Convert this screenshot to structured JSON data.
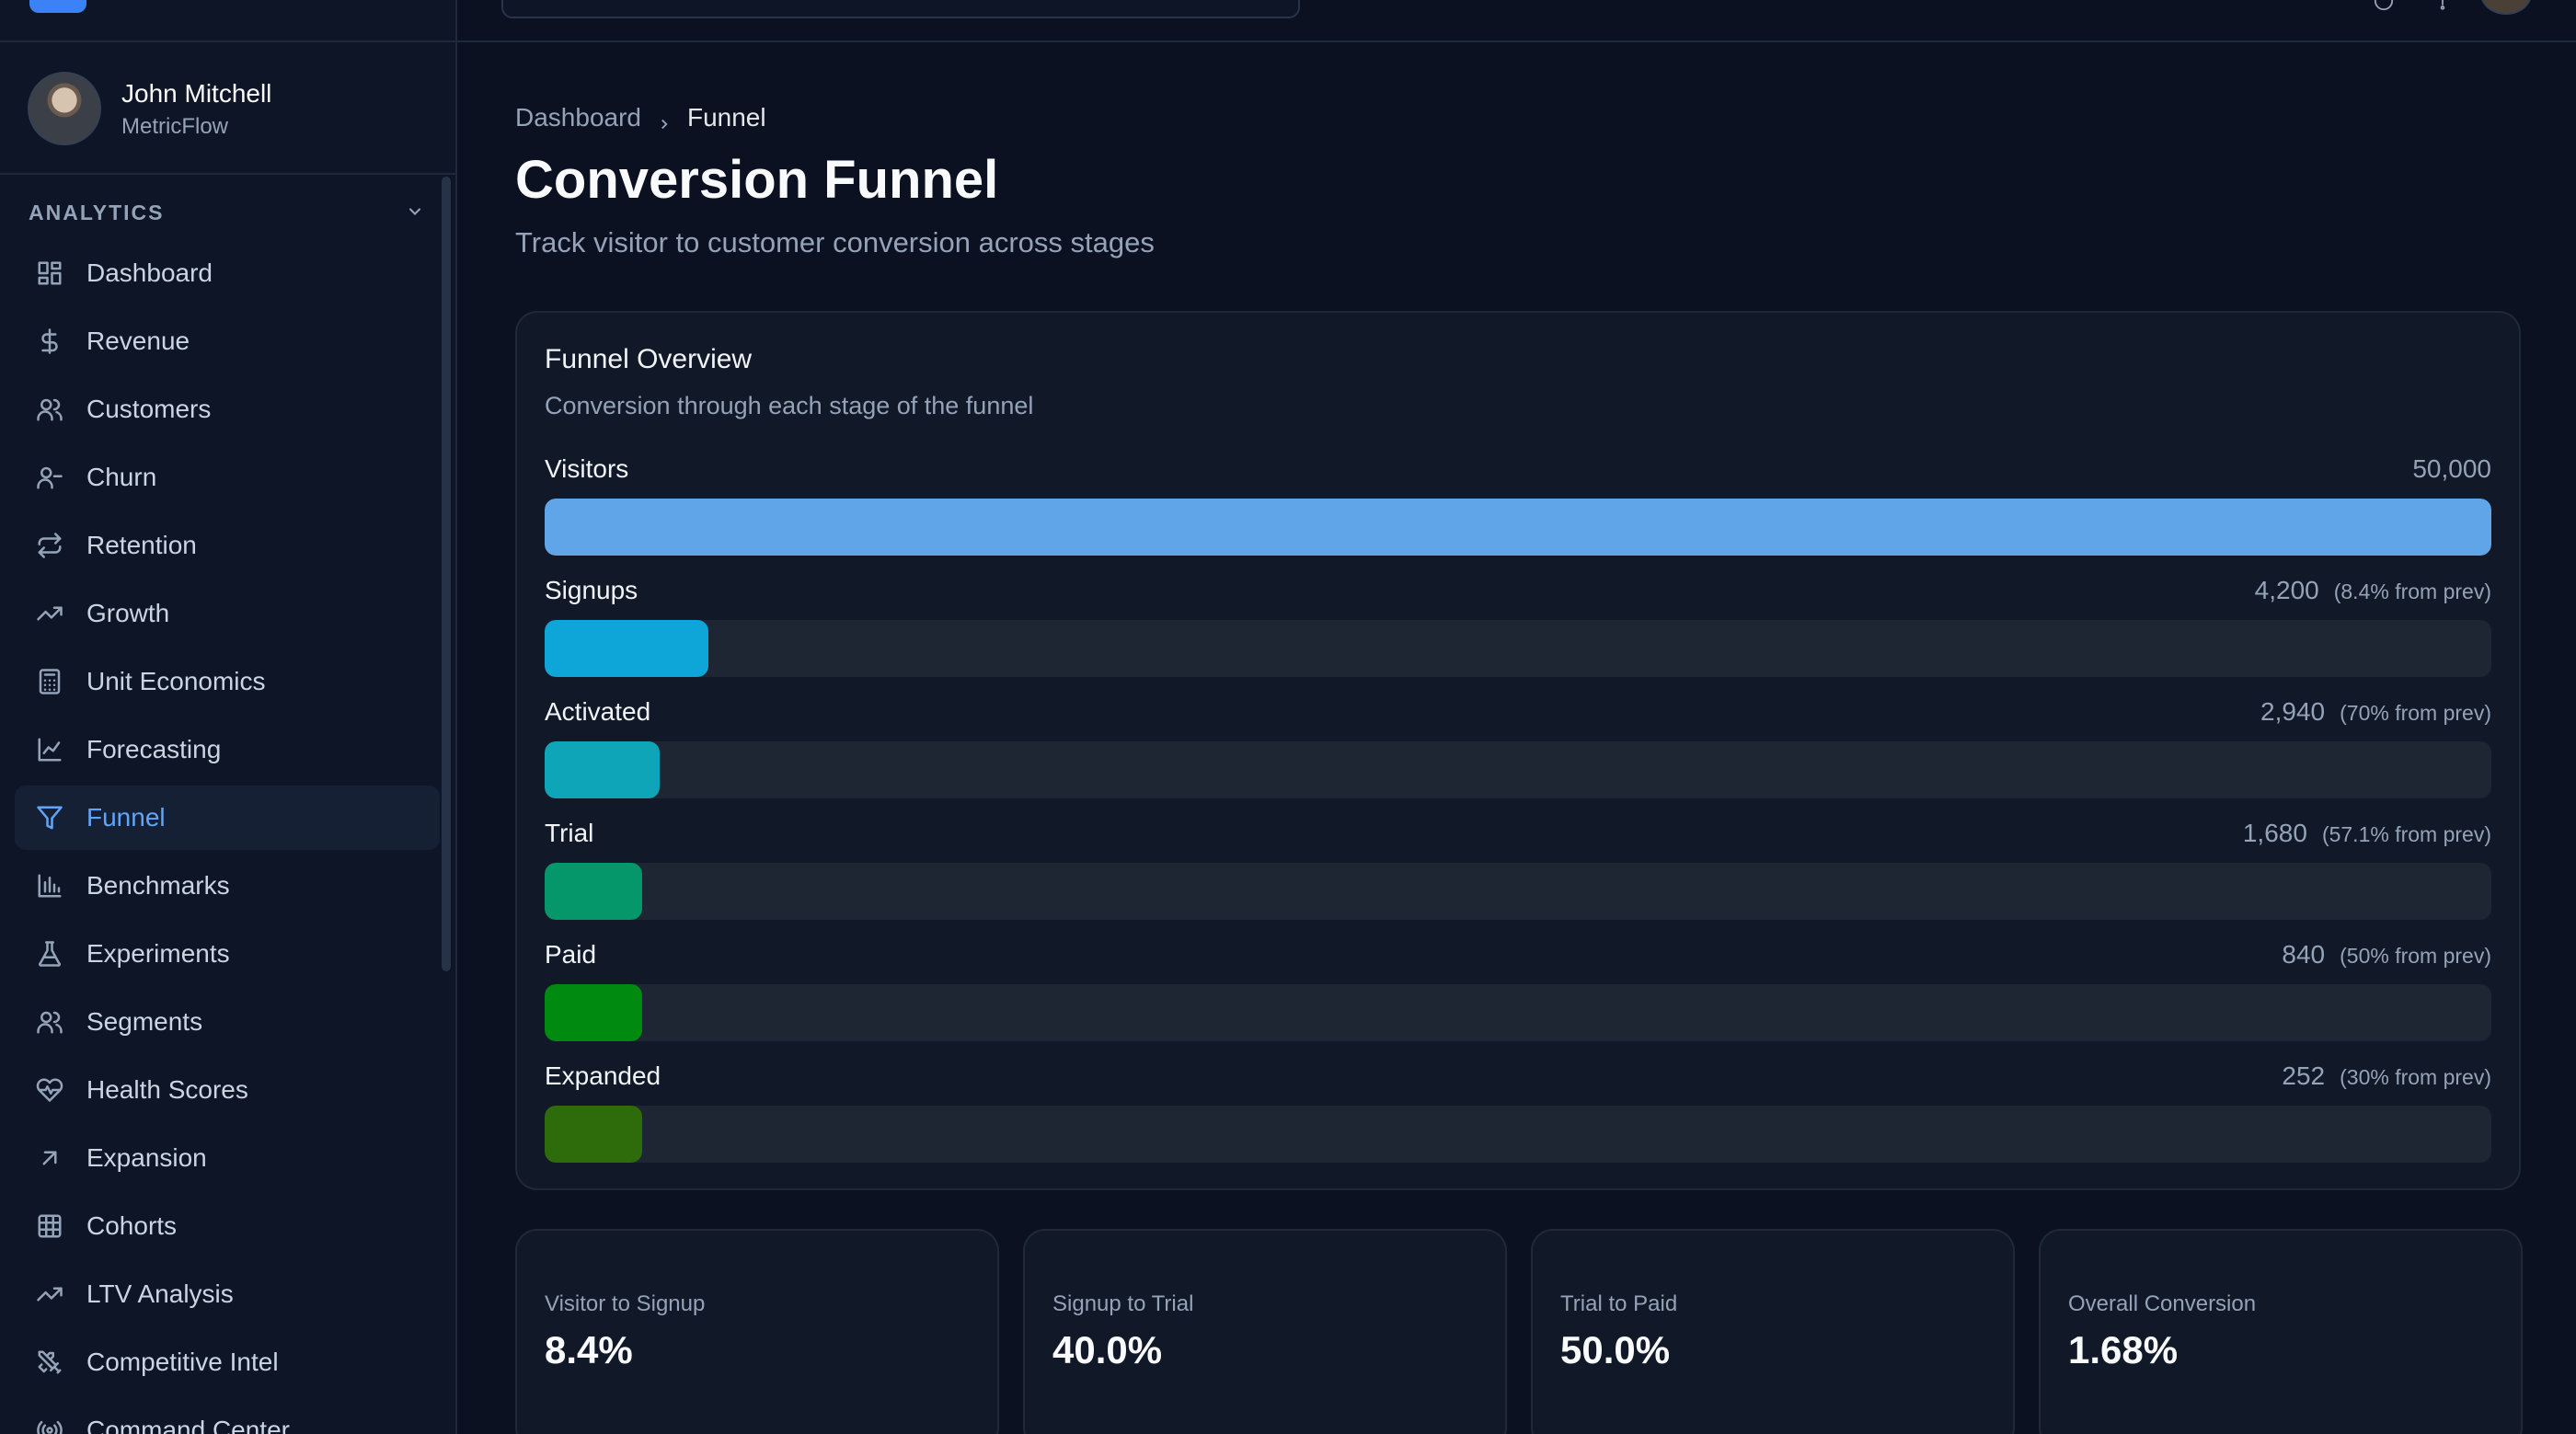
{
  "user": {
    "name": "John Mitchell",
    "org": "MetricFlow"
  },
  "sidebar": {
    "section_title": "ANALYTICS",
    "items": [
      {
        "label": "Dashboard",
        "icon": "dashboard-icon"
      },
      {
        "label": "Revenue",
        "icon": "dollar-icon"
      },
      {
        "label": "Customers",
        "icon": "users-icon"
      },
      {
        "label": "Churn",
        "icon": "user-minus-icon"
      },
      {
        "label": "Retention",
        "icon": "repeat-icon"
      },
      {
        "label": "Growth",
        "icon": "trending-up-icon"
      },
      {
        "label": "Unit Economics",
        "icon": "calculator-icon"
      },
      {
        "label": "Forecasting",
        "icon": "line-chart-icon"
      },
      {
        "label": "Funnel",
        "icon": "filter-icon",
        "active": true
      },
      {
        "label": "Benchmarks",
        "icon": "bar-chart-icon"
      },
      {
        "label": "Experiments",
        "icon": "flask-icon"
      },
      {
        "label": "Segments",
        "icon": "users-icon"
      },
      {
        "label": "Health Scores",
        "icon": "heart-pulse-icon"
      },
      {
        "label": "Expansion",
        "icon": "arrow-up-right-icon"
      },
      {
        "label": "Cohorts",
        "icon": "grid-icon"
      },
      {
        "label": "LTV Analysis",
        "icon": "trending-up-icon"
      },
      {
        "label": "Competitive Intel",
        "icon": "swords-icon"
      },
      {
        "label": "Command Center",
        "icon": "radio-icon"
      }
    ]
  },
  "breadcrumb": {
    "parent": "Dashboard",
    "current": "Funnel"
  },
  "page": {
    "title": "Conversion Funnel",
    "subtitle": "Track visitor to customer conversion across stages"
  },
  "funnel": {
    "title": "Funnel Overview",
    "subtitle": "Conversion through each stage of the funnel",
    "stages": [
      {
        "label": "Visitors",
        "value": "50,000",
        "rate": "",
        "fraction": 1.0,
        "color": "#60a5e8"
      },
      {
        "label": "Signups",
        "value": "4,200",
        "rate": "(8.4% from prev)",
        "fraction": 0.084,
        "color": "#0ea5d9"
      },
      {
        "label": "Activated",
        "value": "2,940",
        "rate": "(70% from prev)",
        "fraction": 0.059,
        "color": "#0ea5b8"
      },
      {
        "label": "Trial",
        "value": "1,680",
        "rate": "(57.1% from prev)",
        "fraction": 0.05,
        "color": "#059669"
      },
      {
        "label": "Paid",
        "value": "840",
        "rate": "(50% from prev)",
        "fraction": 0.05,
        "color": "#008a10"
      },
      {
        "label": "Expanded",
        "value": "252",
        "rate": "(30% from prev)",
        "fraction": 0.05,
        "color": "#2e6b0a"
      }
    ]
  },
  "kpis": [
    {
      "label": "Visitor to Signup",
      "value": "8.4%"
    },
    {
      "label": "Signup to Trial",
      "value": "40.0%"
    },
    {
      "label": "Trial to Paid",
      "value": "50.0%"
    },
    {
      "label": "Overall Conversion",
      "value": "1.68%"
    }
  ],
  "chart_data": {
    "type": "bar",
    "categories": [
      "Visitors",
      "Signups",
      "Activated",
      "Trial",
      "Paid",
      "Expanded"
    ],
    "values": [
      50000,
      4200,
      2940,
      1680,
      840,
      252
    ],
    "title": "Funnel Overview",
    "xlabel": "",
    "ylabel": ""
  }
}
